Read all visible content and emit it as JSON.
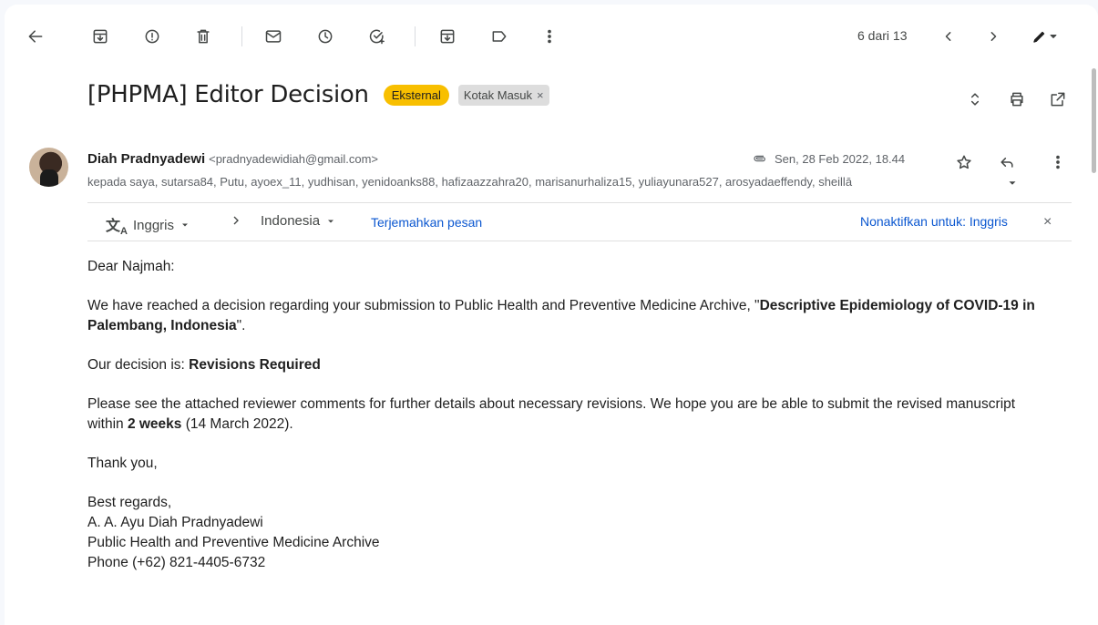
{
  "toolbar": {
    "pager": "6 dari 13"
  },
  "subject": {
    "title": "[PHPMA] Editor Decision",
    "badge_external": "Eksternal",
    "badge_inbox": "Kotak Masuk",
    "badge_inbox_close": "×"
  },
  "sender": {
    "name": "Diah Pradnyadewi",
    "email": "<pradnyadewidiah@gmail.com>",
    "date": "Sen, 28 Feb 2022, 18.44",
    "recipients": "kepada saya, sutarsa84, Putu, ayoex_11, yudhisan, yenidoanks88, hafizaazzahra20, marisanurhaliza15, yuliayunara527, arosyadaeffendy, sheillā"
  },
  "translate": {
    "source_lang": "Inggris",
    "target_lang": "Indonesia",
    "translate_link": "Terjemahkan pesan",
    "disable_link": "Nonaktifkan untuk: Inggris",
    "close": "×"
  },
  "body": {
    "greeting": "Dear Najmah:",
    "p1_prefix": "We have reached a decision regarding your submission to Public Health and Preventive Medicine Archive, \"",
    "p1_bold": "Descriptive Epidemiology of COVID-19 in Palembang, Indonesia",
    "p1_suffix": "\".",
    "p2_prefix": "Our decision is: ",
    "p2_bold": "Revisions Required",
    "p3_prefix": "Please see the attached reviewer comments for further details about necessary revisions. We hope you are be able to submit the revised manuscript within ",
    "p3_bold": "2 weeks",
    "p3_suffix": " (14 March 2022).",
    "thanks": "Thank you,",
    "sig_line1": "Best regards,",
    "sig_line2": "A. A. Ayu Diah Pradnyadewi",
    "sig_line3": "Public Health and Preventive Medicine Archive",
    "sig_line4": "Phone (+62) 821-4405-6732"
  },
  "icons": {
    "back": "arrow-left-icon",
    "archive": "archive-icon",
    "report_spam": "report-icon",
    "delete": "trash-icon",
    "mark_unread": "mail-icon",
    "snooze": "clock-icon",
    "add_task": "add-task-icon",
    "move_to": "move-to-icon",
    "labels": "label-icon",
    "more": "more-vert-icon",
    "prev": "chevron-left-icon",
    "next": "chevron-right-icon",
    "edit": "pen-icon",
    "expand": "unfold-icon",
    "print": "print-icon",
    "open_new": "open-in-new-icon",
    "attachment": "attachment-icon",
    "star": "star-icon",
    "reply": "reply-icon",
    "translate": "translate-icon"
  }
}
